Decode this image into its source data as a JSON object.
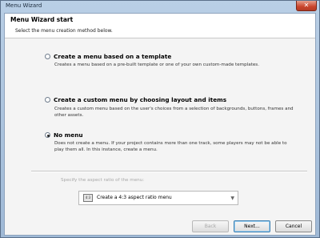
{
  "window": {
    "title": "Menu Wizard",
    "close_glyph": "✕"
  },
  "header": {
    "title": "Menu Wizard start",
    "subtitle": "Select the menu creation method below."
  },
  "options": [
    {
      "label": "Create a menu based on a template",
      "description": "Creates a menu based on a pre-built template or one of your own custom-made templates.",
      "selected": false
    },
    {
      "label": "Create a custom menu by choosing layout and items",
      "description": "Creates a custom menu based on the user's choices from a selection of backgrounds, buttons, frames and other assets.",
      "selected": false
    },
    {
      "label": "No menu",
      "description": "Does not create a menu. If your project contains more than one track, some players may not be able to play them all. In this instance, create a menu.",
      "selected": true
    }
  ],
  "aspect": {
    "label": "Specify the aspect ratio of the menu:",
    "icon_text": "4:3",
    "selected": "Create a 4:3 aspect ratio menu"
  },
  "buttons": {
    "back": "Back",
    "next": "Next...",
    "cancel": "Cancel"
  }
}
